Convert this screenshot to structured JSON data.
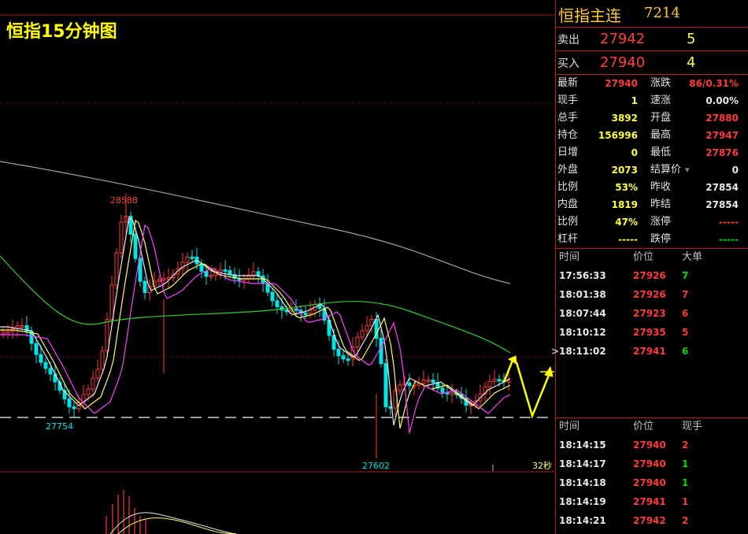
{
  "chart": {
    "title": "恒指15分钟图",
    "high_label": "28588",
    "low1_label": "27754",
    "low2_label": "27602",
    "timer_label": "32秒",
    "colors": {
      "up": "#ff3a3a",
      "down": "#00e5e5",
      "ma_white": "#e8e8e8",
      "ma_yellow": "#ffff60",
      "ma_magenta": "#ff40ff",
      "ma_green": "#30d030",
      "ma_gray": "#a0a0a0",
      "grid": "#a02020",
      "arrow": "#ffff00"
    }
  },
  "panel": {
    "name": "恒指主连",
    "code": "7214",
    "ask": {
      "label": "卖出",
      "price": "27942",
      "vol": "5"
    },
    "bid": {
      "label": "买入",
      "price": "27940",
      "vol": "4"
    },
    "quotes": [
      {
        "k": "最新",
        "v": "27940",
        "c": "red"
      },
      {
        "k": "涨跌",
        "v": "86/0.31%",
        "c": "red"
      },
      {
        "k": "现手",
        "v": "1",
        "c": "yel"
      },
      {
        "k": "速涨",
        "v": "0.00%",
        "c": "wht"
      },
      {
        "k": "总手",
        "v": "3892",
        "c": "yel"
      },
      {
        "k": "开盘",
        "v": "27880",
        "c": "red"
      },
      {
        "k": "持仓",
        "v": "156996",
        "c": "yel"
      },
      {
        "k": "最高",
        "v": "27947",
        "c": "red"
      },
      {
        "k": "日增",
        "v": "0",
        "c": "yel"
      },
      {
        "k": "最低",
        "v": "27876",
        "c": "red"
      },
      {
        "k": "外盘",
        "v": "2073",
        "c": "yel"
      },
      {
        "k": "结算价",
        "v": "0",
        "c": "wht"
      },
      {
        "k": "比例",
        "v": "53%",
        "c": "yel"
      },
      {
        "k": "昨收",
        "v": "27854",
        "c": "wht"
      },
      {
        "k": "内盘",
        "v": "1819",
        "c": "yel"
      },
      {
        "k": "昨结",
        "v": "27854",
        "c": "wht"
      },
      {
        "k": "比例",
        "v": "47%",
        "c": "yel"
      },
      {
        "k": "涨停",
        "v": "-----",
        "c": "red"
      },
      {
        "k": "杠杆",
        "v": "-----",
        "c": "yel"
      },
      {
        "k": "跌停",
        "v": "-----",
        "c": "grn"
      }
    ],
    "big_trades": {
      "headers": [
        "时间",
        "价位",
        "大单"
      ],
      "rows": [
        {
          "t": "17:56:33",
          "p": "27926",
          "v": "7",
          "c": "grn"
        },
        {
          "t": "18:01:38",
          "p": "27926",
          "v": "7",
          "c": "red"
        },
        {
          "t": "18:07:44",
          "p": "27923",
          "v": "6",
          "c": "red"
        },
        {
          "t": "18:10:12",
          "p": "27935",
          "v": "5",
          "c": "red"
        },
        {
          "t": "18:11:02",
          "p": "27941",
          "v": "6",
          "c": "grn"
        }
      ]
    },
    "ticks": {
      "headers": [
        "时间",
        "价位",
        "现手"
      ],
      "rows": [
        {
          "t": "18:14:15",
          "p": "27940",
          "v": "2",
          "c": "red"
        },
        {
          "t": "18:14:17",
          "p": "27940",
          "v": "1",
          "c": "grn"
        },
        {
          "t": "18:14:18",
          "p": "27940",
          "v": "1",
          "c": "grn"
        },
        {
          "t": "18:14:19",
          "p": "27941",
          "v": "1",
          "c": "red"
        },
        {
          "t": "18:14:21",
          "p": "27942",
          "v": "2",
          "c": "red"
        }
      ]
    }
  }
}
